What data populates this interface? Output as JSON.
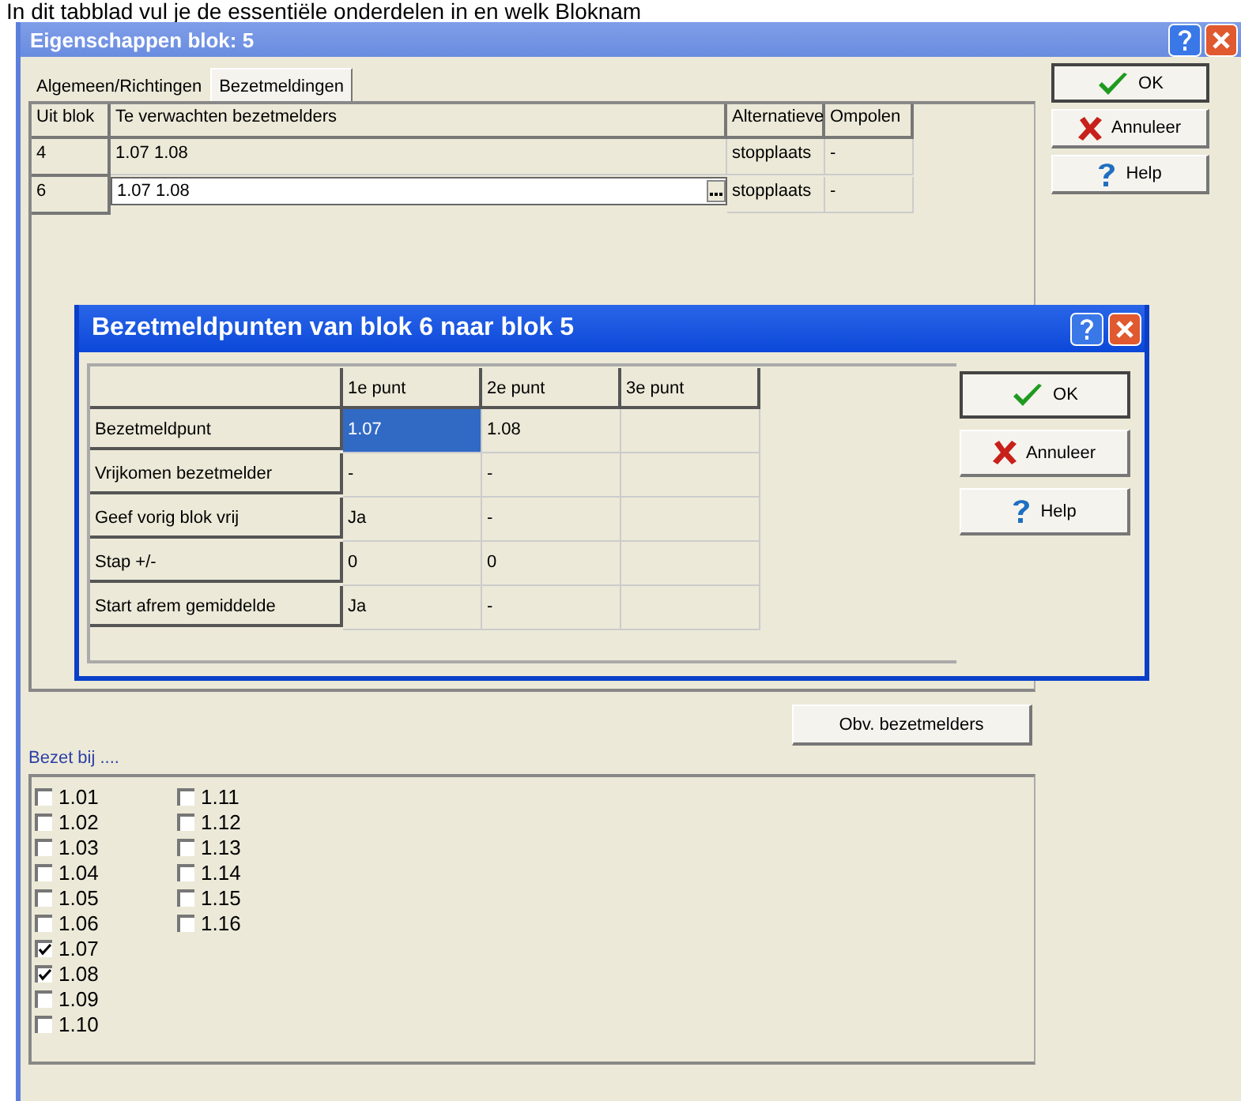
{
  "caption": "In dit tabblad vul je de essentiële onderdelen in en welk Bloknam",
  "window": {
    "title": "Eigenschappen blok: 5"
  },
  "tabs": [
    {
      "label": "Algemeen/Richtingen",
      "selected": false
    },
    {
      "label": "Bezetmeldingen",
      "selected": true
    }
  ],
  "table": {
    "columns": [
      "Uit blok",
      "Te verwachten bezetmelders",
      "Alternatieve",
      "Ompolen"
    ],
    "rows": [
      {
        "cells": [
          "4",
          "1.07  1.08",
          "stopplaats",
          "-"
        ],
        "editing": false
      },
      {
        "cells": [
          "6",
          "1.07  1.08",
          "stopplaats",
          "-"
        ],
        "editing": true
      }
    ]
  },
  "buttons": [
    {
      "label": "OK",
      "kind": "ok"
    },
    {
      "label": "Annuleer",
      "kind": "cancel"
    },
    {
      "label": "Help",
      "kind": "help"
    }
  ],
  "dialog": {
    "title": "Bezetmeldpunten van blok 6 naar blok 5",
    "columns": [
      "1e punt",
      "2e punt",
      "3e punt"
    ],
    "rows": [
      {
        "label": "Bezetmeldpunt",
        "cells": [
          {
            "text": "1.07",
            "selected": true
          },
          {
            "text": "1.08",
            "selected": false
          }
        ]
      },
      {
        "label": "Vrijkomen bezetmelder",
        "cells": [
          {
            "text": "-",
            "selected": false
          },
          {
            "text": "-",
            "selected": false
          }
        ]
      },
      {
        "label": "Geef vorig blok vrij",
        "cells": [
          {
            "text": "Ja",
            "selected": false
          },
          {
            "text": "-",
            "selected": false
          }
        ]
      },
      {
        "label": "Stap +/-",
        "cells": [
          {
            "text": "0",
            "selected": false
          },
          {
            "text": "0",
            "selected": false
          }
        ]
      },
      {
        "label": "Start afrem gemiddelde",
        "cells": [
          {
            "text": "Ja",
            "selected": false
          },
          {
            "text": "-",
            "selected": false
          }
        ]
      }
    ],
    "buttons": [
      {
        "label": "OK",
        "kind": "ok"
      },
      {
        "label": "Annuleer",
        "kind": "cancel"
      },
      {
        "label": "Help",
        "kind": "help"
      }
    ]
  },
  "bezet_label": "Bezet bij ....",
  "obv_button": "Obv. bezetmelders",
  "checkboxes": [
    {
      "label": "1.01",
      "checked": false
    },
    {
      "label": "1.02",
      "checked": false
    },
    {
      "label": "1.03",
      "checked": false
    },
    {
      "label": "1.04",
      "checked": false
    },
    {
      "label": "1.05",
      "checked": false
    },
    {
      "label": "1.06",
      "checked": false
    },
    {
      "label": "1.07",
      "checked": true
    },
    {
      "label": "1.08",
      "checked": true
    },
    {
      "label": "1.09",
      "checked": false
    },
    {
      "label": "1.10",
      "checked": false
    },
    {
      "label": "1.11",
      "checked": false
    },
    {
      "label": "1.12",
      "checked": false
    },
    {
      "label": "1.13",
      "checked": false
    },
    {
      "label": "1.14",
      "checked": false
    },
    {
      "label": "1.15",
      "checked": false
    },
    {
      "label": "1.16",
      "checked": false
    }
  ]
}
